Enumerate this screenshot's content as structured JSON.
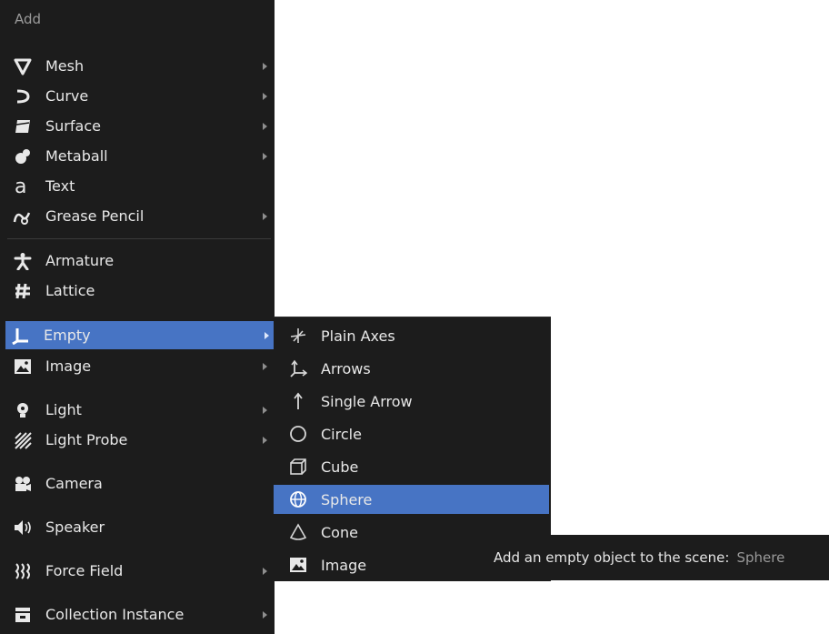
{
  "menu": {
    "title": "Add",
    "items": [
      {
        "label": "Mesh",
        "icon": "mesh-icon"
      },
      {
        "label": "Curve",
        "icon": "curve-icon"
      },
      {
        "label": "Surface",
        "icon": "surface-icon"
      },
      {
        "label": "Metaball",
        "icon": "metaball-icon"
      },
      {
        "label": "Text",
        "icon": "text-icon"
      },
      {
        "label": "Grease Pencil",
        "icon": "grease-pencil-icon"
      },
      {
        "label": "Armature",
        "icon": "armature-icon"
      },
      {
        "label": "Lattice",
        "icon": "lattice-icon"
      },
      {
        "label": "Empty",
        "icon": "empty-icon"
      },
      {
        "label": "Image",
        "icon": "image-icon"
      },
      {
        "label": "Light",
        "icon": "light-icon"
      },
      {
        "label": "Light Probe",
        "icon": "light-probe-icon"
      },
      {
        "label": "Camera",
        "icon": "camera-icon"
      },
      {
        "label": "Speaker",
        "icon": "speaker-icon"
      },
      {
        "label": "Force Field",
        "icon": "force-field-icon"
      },
      {
        "label": "Collection Instance",
        "icon": "collection-instance-icon"
      }
    ]
  },
  "submenu": {
    "items": [
      {
        "label": "Plain Axes",
        "icon": "plain-axes-icon"
      },
      {
        "label": "Arrows",
        "icon": "arrows-icon"
      },
      {
        "label": "Single Arrow",
        "icon": "single-arrow-icon"
      },
      {
        "label": "Circle",
        "icon": "circle-icon"
      },
      {
        "label": "Cube",
        "icon": "cube-icon"
      },
      {
        "label": "Sphere",
        "icon": "sphere-icon"
      },
      {
        "label": "Cone",
        "icon": "cone-icon"
      },
      {
        "label": "Image",
        "icon": "image-empty-icon"
      }
    ]
  },
  "tooltip": {
    "text": "Add an empty object to the scene:",
    "value": "Sphere"
  },
  "colors": {
    "menu_bg": "#1c1c1c",
    "highlight": "#4774c4",
    "text": "#e8e8e8",
    "muted": "#9a9a9a"
  }
}
